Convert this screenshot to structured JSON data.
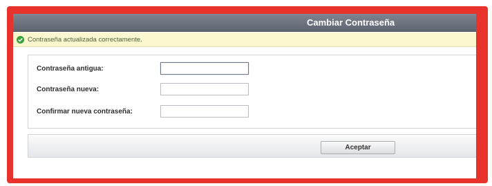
{
  "dialog": {
    "title": "Cambiar Contraseña"
  },
  "notice": {
    "icon": "check-circle-icon",
    "message": "Contraseña actualizada correctamente."
  },
  "form": {
    "fields": [
      {
        "label": "Contraseña antigua:",
        "value": ""
      },
      {
        "label": "Contraseña nueva:",
        "value": ""
      },
      {
        "label": "Confirmar nueva contraseña:",
        "value": ""
      }
    ]
  },
  "actions": {
    "accept_label": "Aceptar"
  },
  "colors": {
    "frame_border": "#e8332d",
    "titlebar": "#6b717c",
    "notice_bg": "#fbf8cf",
    "success_icon": "#3aa23a"
  }
}
